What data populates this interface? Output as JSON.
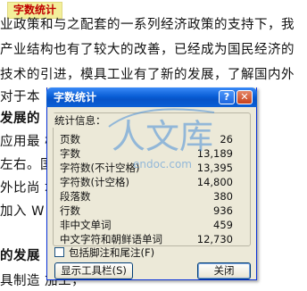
{
  "document": {
    "heading": "字数统计",
    "lines": [
      {
        "text": "业政策和与之配套的一系列经济政策的支持下，我",
        "bold": false
      },
      {
        "text": "产业结构也有了较大的改善，已经成为国民经济的",
        "bold": false
      },
      {
        "text": "技术的引进，模具工业有了新的发展，了解国内外",
        "bold": false
      },
      {
        "text": "对于本",
        "bold": false
      },
      {
        "text": "发展的",
        "bold": true
      },
      {
        "text": "应用最                                         模具行",
        "bold": false
      },
      {
        "text": "左右。国                                       际的几",
        "bold": false
      },
      {
        "text": "外比尚                                       域：汽",
        "bold": false
      },
      {
        "text": "加入 W                                        个档次",
        "bold": false
      },
      {
        "text": "",
        "bold": false
      },
      {
        "text": "的发展",
        "bold": true
      },
      {
        "text": "具制造                                          加工，",
        "bold": false
      }
    ]
  },
  "dialog": {
    "title": "字数统计",
    "help_glyph": "?",
    "close_glyph": "✕",
    "group_label": "统计信息：",
    "stats": [
      {
        "label": "页数",
        "value": "26"
      },
      {
        "label": "字数",
        "value": "13,189"
      },
      {
        "label": "字符数(不计空格)",
        "value": "13,395"
      },
      {
        "label": "字符数(计空格)",
        "value": "14,800"
      },
      {
        "label": "段落数",
        "value": "380"
      },
      {
        "label": "行数",
        "value": "936"
      },
      {
        "label": "非中文单词",
        "value": "459"
      },
      {
        "label": "中文字符和朝鲜语单词",
        "value": "12,730"
      }
    ],
    "checkbox_label": "包括脚注和尾注(F)",
    "checkbox_checked": false,
    "toolbar_button": "显示工具栏(S)",
    "close_button": "关闭"
  },
  "watermark": {
    "main": "人文库",
    "sub": "endoc.com"
  },
  "colors": {
    "titlebar": "#0a5fd6",
    "dialog_bg": "#ece9d8",
    "heading_text": "#c00000",
    "heading_bg": "#f3ef9a",
    "watermark": "#4a90d9"
  }
}
